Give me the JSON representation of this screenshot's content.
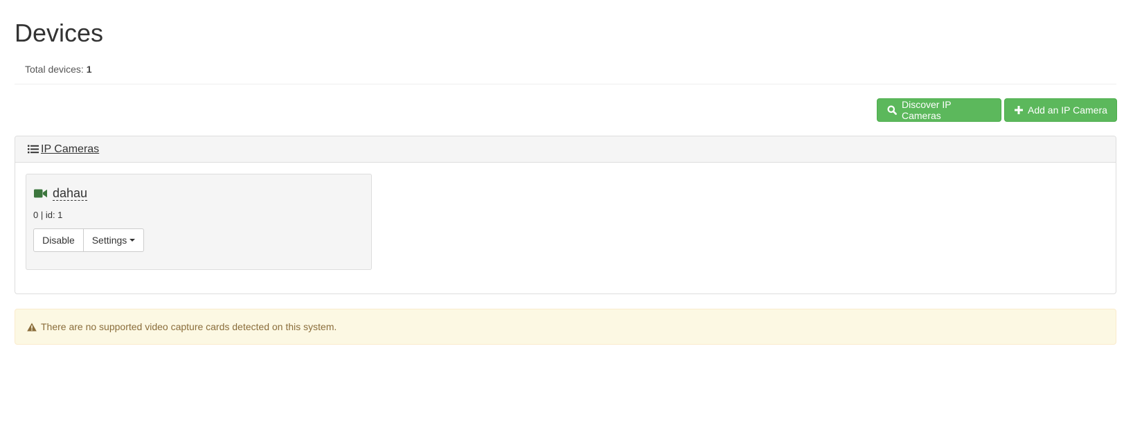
{
  "header": {
    "title": "Devices",
    "total_label": "Total devices: ",
    "total_count": "1"
  },
  "toolbar": {
    "discover_label": "Discover IP Cameras",
    "discover_icon": "search-icon",
    "add_label": "Add an IP Camera",
    "add_icon": "plus-icon",
    "button_color": "#5cb85c"
  },
  "ip_cameras_panel": {
    "title": "IP Cameras",
    "title_icon": "list-icon",
    "cameras": [
      {
        "name": "dahau",
        "icon": "video-camera-icon",
        "icon_color": "#3c763d",
        "meta": "0 | id: 1",
        "disable_label": "Disable",
        "settings_label": "Settings"
      }
    ]
  },
  "alert": {
    "icon": "warning-icon",
    "message": "There are no supported video capture cards detected on this system.",
    "color": "#8a6d3b",
    "background": "#fcf8e3"
  }
}
